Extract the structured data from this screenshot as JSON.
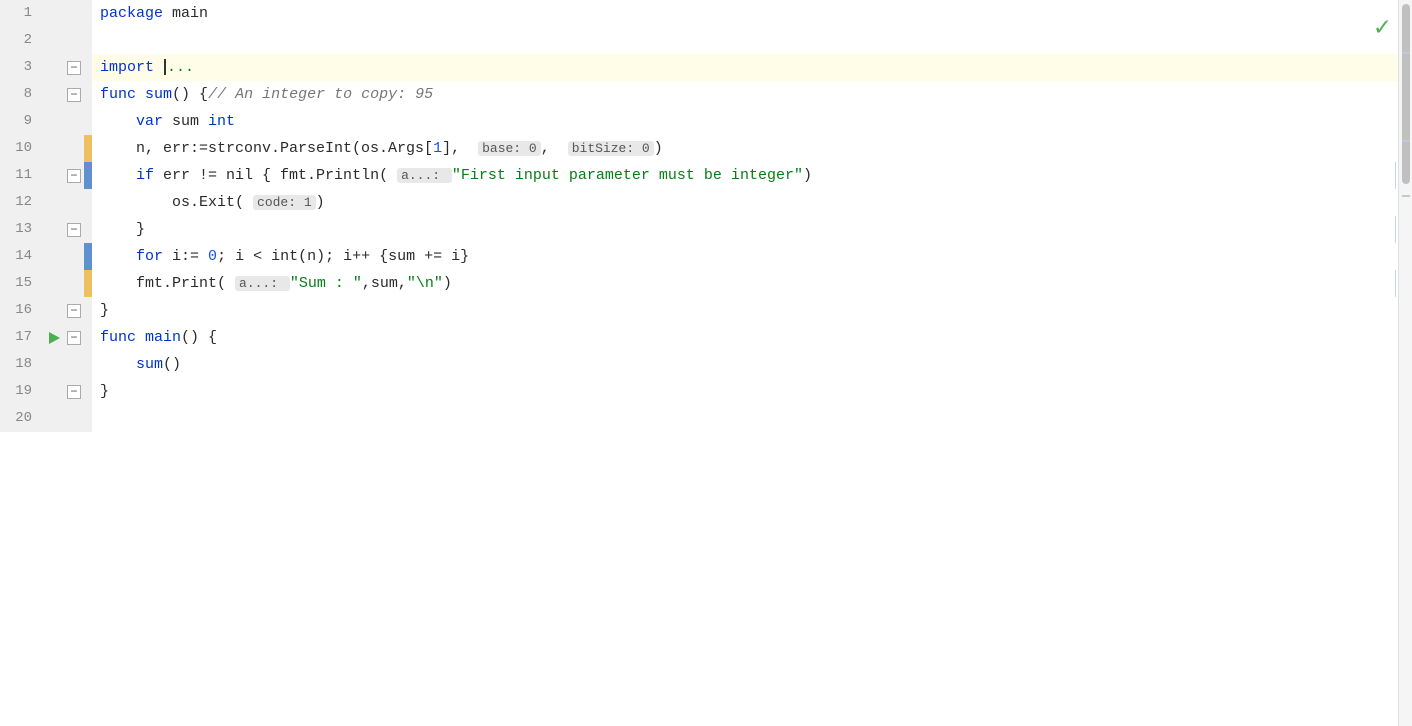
{
  "editor": {
    "checkmark": "✓",
    "lines": [
      {
        "num": 1,
        "content_html": "<span class='kw'>package</span> main",
        "fold": "",
        "debug": "",
        "highlighted": false,
        "run": false
      },
      {
        "num": 2,
        "content_html": "",
        "fold": "",
        "debug": "",
        "highlighted": false,
        "run": false
      },
      {
        "num": 3,
        "content_html": "<span class='kw'>import</span> <span class='cursor'></span><span style='color:#067d17'>...</span>",
        "fold": "minus",
        "debug": "",
        "highlighted": true,
        "run": false
      },
      {
        "num": 8,
        "content_html": "<span class='kw'>func</span> <span class='fn'>sum</span>() {<span class='cm'>// An integer to copy: 95</span>",
        "fold": "minus",
        "debug": "",
        "highlighted": false,
        "run": false
      },
      {
        "num": 9,
        "content_html": "    <span class='kw'>var</span> sum <span class='kw'>int</span>",
        "fold": "",
        "debug": "",
        "highlighted": false,
        "run": false
      },
      {
        "num": 10,
        "content_html": "    n, err:=strconv.ParseInt(os.Args[<span class='num'>1</span>],  <span class='param-hint'>base: 0</span>,  <span class='param-hint'>bitSize: 0</span>)",
        "fold": "",
        "debug": "yellow",
        "highlighted": false,
        "run": false
      },
      {
        "num": 11,
        "content_html": "    <span class='kw'>if</span> err != nil { fmt.Println( <span class='param-hint'>a...: </span><span class='str'>\"First input parameter must be integer\"</span>)",
        "fold": "minus",
        "debug": "blue",
        "highlighted": false,
        "run": false
      },
      {
        "num": 12,
        "content_html": "        os.Exit( <span class='param-hint'>code: 1</span>)",
        "fold": "",
        "debug": "",
        "highlighted": false,
        "run": false
      },
      {
        "num": 13,
        "content_html": "    }",
        "fold": "minus",
        "debug": "",
        "highlighted": false,
        "run": false
      },
      {
        "num": 14,
        "content_html": "    <span class='kw'>for</span> i:= <span class='num'>0</span>; i &lt; int(n); i++ {sum += i}",
        "fold": "",
        "debug": "blue",
        "highlighted": false,
        "run": false
      },
      {
        "num": 15,
        "content_html": "    fmt.Print( <span class='param-hint'>a...: </span><span class='str'>\"Sum : \"</span>,sum,<span class='str'>\"\\n\"</span>)",
        "fold": "",
        "debug": "yellow",
        "highlighted": false,
        "run": false
      },
      {
        "num": 16,
        "content_html": "}",
        "fold": "minus",
        "debug": "",
        "highlighted": false,
        "run": false,
        "run_arrow": true
      },
      {
        "num": 17,
        "content_html": "<span class='kw'>func</span> <span class='fn'>main</span>() {",
        "fold": "minus",
        "debug": "",
        "highlighted": false,
        "run": true
      },
      {
        "num": 18,
        "content_html": "    <span class='fn'>sum</span>()",
        "fold": "",
        "debug": "",
        "highlighted": false,
        "run": false
      },
      {
        "num": 19,
        "content_html": "}",
        "fold": "minus",
        "debug": "",
        "highlighted": false,
        "run": false
      },
      {
        "num": 20,
        "content_html": "",
        "fold": "",
        "debug": "",
        "highlighted": false,
        "run": false
      }
    ]
  }
}
